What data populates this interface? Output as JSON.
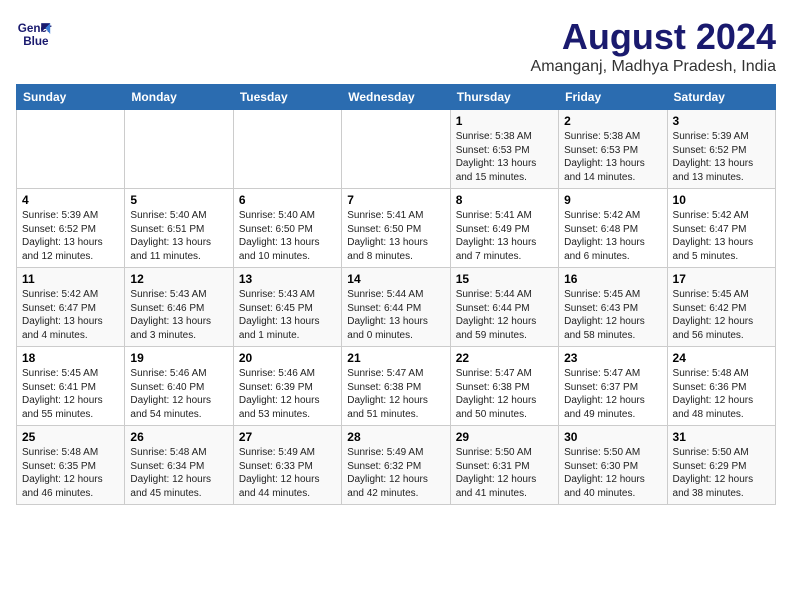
{
  "logo": {
    "line1": "General",
    "line2": "Blue"
  },
  "title": "August 2024",
  "subtitle": "Amanganj, Madhya Pradesh, India",
  "days_of_week": [
    "Sunday",
    "Monday",
    "Tuesday",
    "Wednesday",
    "Thursday",
    "Friday",
    "Saturday"
  ],
  "weeks": [
    [
      {
        "day": "",
        "info": ""
      },
      {
        "day": "",
        "info": ""
      },
      {
        "day": "",
        "info": ""
      },
      {
        "day": "",
        "info": ""
      },
      {
        "day": "1",
        "info": "Sunrise: 5:38 AM\nSunset: 6:53 PM\nDaylight: 13 hours\nand 15 minutes."
      },
      {
        "day": "2",
        "info": "Sunrise: 5:38 AM\nSunset: 6:53 PM\nDaylight: 13 hours\nand 14 minutes."
      },
      {
        "day": "3",
        "info": "Sunrise: 5:39 AM\nSunset: 6:52 PM\nDaylight: 13 hours\nand 13 minutes."
      }
    ],
    [
      {
        "day": "4",
        "info": "Sunrise: 5:39 AM\nSunset: 6:52 PM\nDaylight: 13 hours\nand 12 minutes."
      },
      {
        "day": "5",
        "info": "Sunrise: 5:40 AM\nSunset: 6:51 PM\nDaylight: 13 hours\nand 11 minutes."
      },
      {
        "day": "6",
        "info": "Sunrise: 5:40 AM\nSunset: 6:50 PM\nDaylight: 13 hours\nand 10 minutes."
      },
      {
        "day": "7",
        "info": "Sunrise: 5:41 AM\nSunset: 6:50 PM\nDaylight: 13 hours\nand 8 minutes."
      },
      {
        "day": "8",
        "info": "Sunrise: 5:41 AM\nSunset: 6:49 PM\nDaylight: 13 hours\nand 7 minutes."
      },
      {
        "day": "9",
        "info": "Sunrise: 5:42 AM\nSunset: 6:48 PM\nDaylight: 13 hours\nand 6 minutes."
      },
      {
        "day": "10",
        "info": "Sunrise: 5:42 AM\nSunset: 6:47 PM\nDaylight: 13 hours\nand 5 minutes."
      }
    ],
    [
      {
        "day": "11",
        "info": "Sunrise: 5:42 AM\nSunset: 6:47 PM\nDaylight: 13 hours\nand 4 minutes."
      },
      {
        "day": "12",
        "info": "Sunrise: 5:43 AM\nSunset: 6:46 PM\nDaylight: 13 hours\nand 3 minutes."
      },
      {
        "day": "13",
        "info": "Sunrise: 5:43 AM\nSunset: 6:45 PM\nDaylight: 13 hours\nand 1 minute."
      },
      {
        "day": "14",
        "info": "Sunrise: 5:44 AM\nSunset: 6:44 PM\nDaylight: 13 hours\nand 0 minutes."
      },
      {
        "day": "15",
        "info": "Sunrise: 5:44 AM\nSunset: 6:44 PM\nDaylight: 12 hours\nand 59 minutes."
      },
      {
        "day": "16",
        "info": "Sunrise: 5:45 AM\nSunset: 6:43 PM\nDaylight: 12 hours\nand 58 minutes."
      },
      {
        "day": "17",
        "info": "Sunrise: 5:45 AM\nSunset: 6:42 PM\nDaylight: 12 hours\nand 56 minutes."
      }
    ],
    [
      {
        "day": "18",
        "info": "Sunrise: 5:45 AM\nSunset: 6:41 PM\nDaylight: 12 hours\nand 55 minutes."
      },
      {
        "day": "19",
        "info": "Sunrise: 5:46 AM\nSunset: 6:40 PM\nDaylight: 12 hours\nand 54 minutes."
      },
      {
        "day": "20",
        "info": "Sunrise: 5:46 AM\nSunset: 6:39 PM\nDaylight: 12 hours\nand 53 minutes."
      },
      {
        "day": "21",
        "info": "Sunrise: 5:47 AM\nSunset: 6:38 PM\nDaylight: 12 hours\nand 51 minutes."
      },
      {
        "day": "22",
        "info": "Sunrise: 5:47 AM\nSunset: 6:38 PM\nDaylight: 12 hours\nand 50 minutes."
      },
      {
        "day": "23",
        "info": "Sunrise: 5:47 AM\nSunset: 6:37 PM\nDaylight: 12 hours\nand 49 minutes."
      },
      {
        "day": "24",
        "info": "Sunrise: 5:48 AM\nSunset: 6:36 PM\nDaylight: 12 hours\nand 48 minutes."
      }
    ],
    [
      {
        "day": "25",
        "info": "Sunrise: 5:48 AM\nSunset: 6:35 PM\nDaylight: 12 hours\nand 46 minutes."
      },
      {
        "day": "26",
        "info": "Sunrise: 5:48 AM\nSunset: 6:34 PM\nDaylight: 12 hours\nand 45 minutes."
      },
      {
        "day": "27",
        "info": "Sunrise: 5:49 AM\nSunset: 6:33 PM\nDaylight: 12 hours\nand 44 minutes."
      },
      {
        "day": "28",
        "info": "Sunrise: 5:49 AM\nSunset: 6:32 PM\nDaylight: 12 hours\nand 42 minutes."
      },
      {
        "day": "29",
        "info": "Sunrise: 5:50 AM\nSunset: 6:31 PM\nDaylight: 12 hours\nand 41 minutes."
      },
      {
        "day": "30",
        "info": "Sunrise: 5:50 AM\nSunset: 6:30 PM\nDaylight: 12 hours\nand 40 minutes."
      },
      {
        "day": "31",
        "info": "Sunrise: 5:50 AM\nSunset: 6:29 PM\nDaylight: 12 hours\nand 38 minutes."
      }
    ]
  ]
}
